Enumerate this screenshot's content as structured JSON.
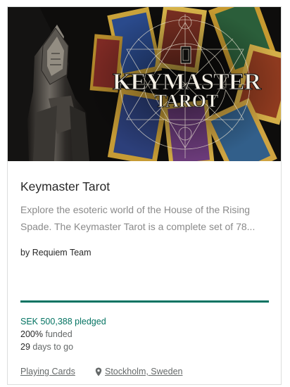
{
  "project": {
    "image_alt": "Keymaster Tarot project image",
    "logo_line1": "KEYMASTER",
    "logo_line2": "TAROT",
    "title": "Keymaster Tarot",
    "blurb_line1": "Explore the esoteric world of the House of the Rising",
    "blurb_line2": "Spade. The Keymaster Tarot is a complete set of 78...",
    "creator_prefix": "by",
    "creator": "Requiem Team"
  },
  "funding": {
    "progress_percent": 100,
    "pledged_amount": "SEK 500,388",
    "pledged_label": "pledged",
    "percent_funded": "200%",
    "funded_label": "funded",
    "days_left": "29",
    "days_label": "days to go"
  },
  "meta": {
    "category": "Playing Cards",
    "location": "Stockholm, Sweden",
    "location_icon": "map-pin-icon"
  },
  "colors": {
    "accent": "#037362",
    "text": "#282828",
    "muted": "#8a8a8a",
    "border": "#dcdedd"
  }
}
